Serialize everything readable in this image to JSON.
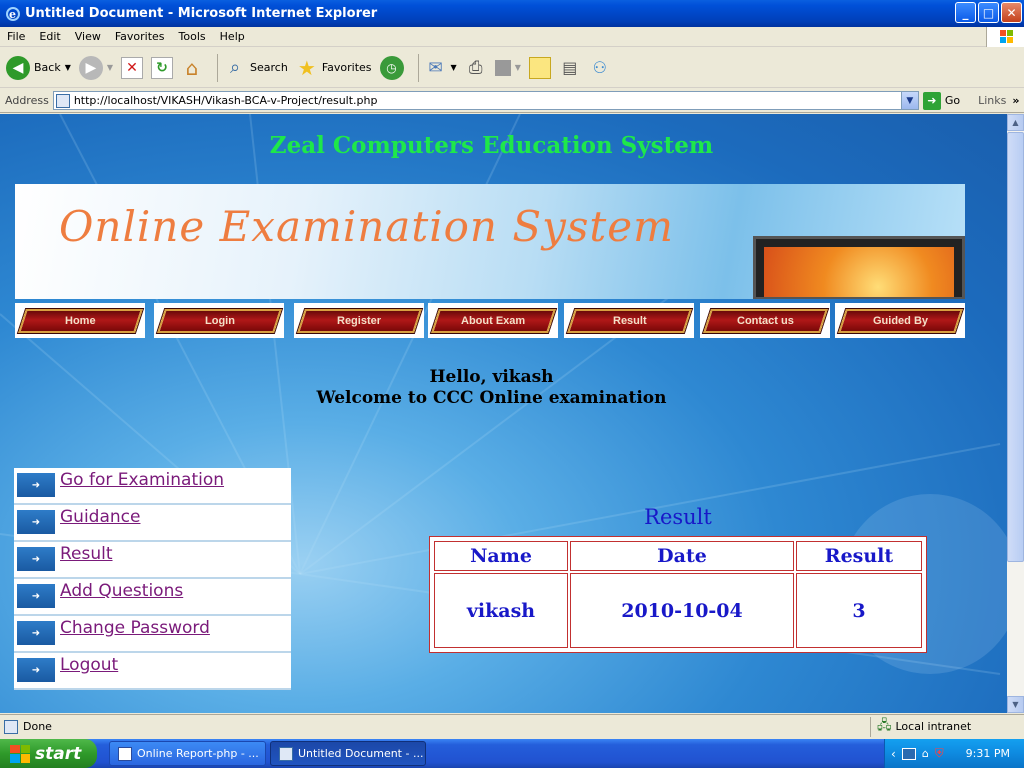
{
  "window": {
    "title": "Untitled Document - Microsoft Internet Explorer",
    "buttons": {
      "minimize": "_",
      "maximize": "□",
      "close": "✕"
    }
  },
  "menubar": [
    "File",
    "Edit",
    "View",
    "Favorites",
    "Tools",
    "Help"
  ],
  "toolbar": {
    "back_label": "Back",
    "search_label": "Search",
    "favorites_label": "Favorites"
  },
  "address": {
    "label": "Address",
    "url": "http://localhost/VIKASH/Vikash-BCA-v-Project/result.php",
    "go_label": "Go",
    "links_label": "Links"
  },
  "page": {
    "site_title": "Zeal Computers Education System",
    "banner_text": "Online Examination System",
    "nav": [
      "Home",
      "Login",
      "Register",
      "About Exam",
      "Result",
      "Contact us",
      "Guided By"
    ],
    "greeting": "Hello, vikash",
    "welcome": "Welcome to CCC Online examination",
    "side_menu": [
      "Go for Examination",
      "Guidance",
      "Result",
      "Add Questions",
      "Change Password",
      "Logout"
    ],
    "result_title": "Result",
    "result_table": {
      "headers": [
        "Name",
        "Date",
        "Result"
      ],
      "rows": [
        [
          "vikash",
          "2010-10-04",
          "3"
        ]
      ]
    }
  },
  "statusbar": {
    "status": "Done",
    "zone": "Local intranet"
  },
  "taskbar": {
    "start_label": "start",
    "tasks": [
      "Online Report-php - ...",
      "Untitled Document - ..."
    ],
    "clock": "9:31 PM"
  },
  "colors": {
    "site_title": "#1ee84a",
    "banner_text": "#ee7d40",
    "result_text": "#1818c8",
    "table_border": "#c23030",
    "link_visited": "#7a1a7a"
  }
}
